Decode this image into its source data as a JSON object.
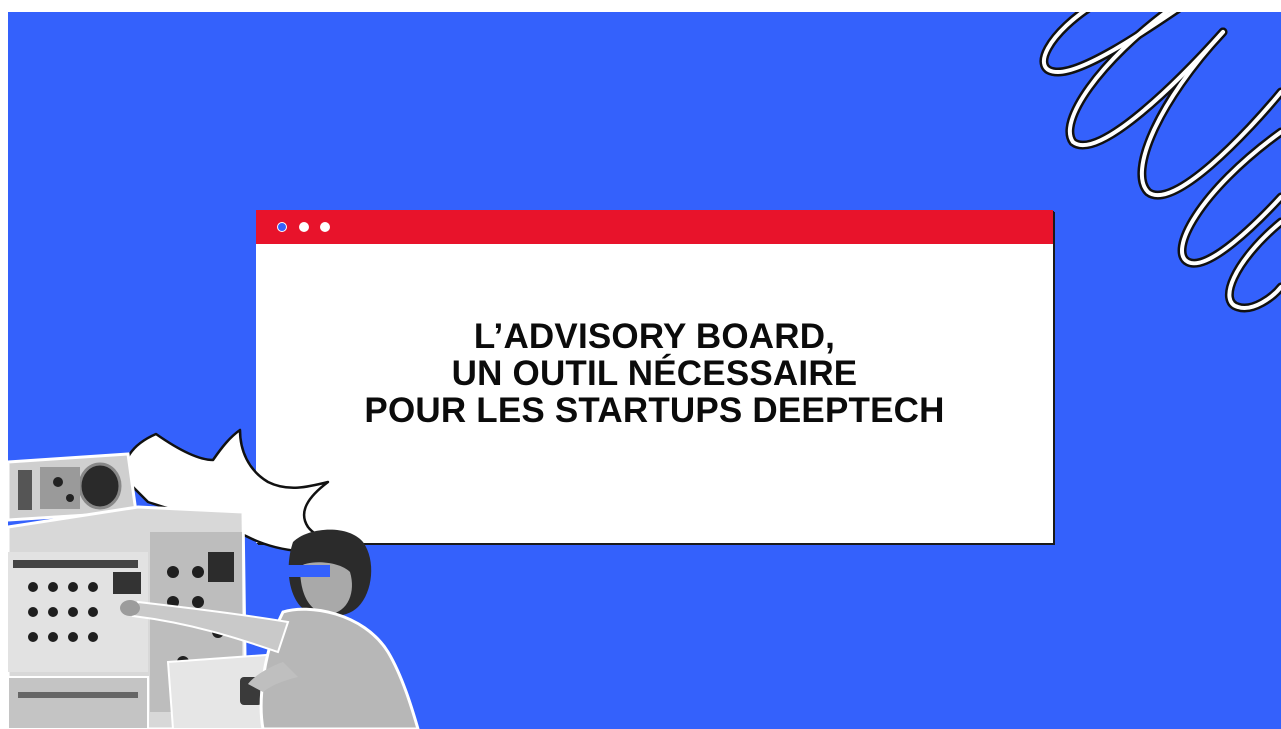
{
  "window": {
    "dot_colors": [
      "#3461fc",
      "#ffffff",
      "#ffffff"
    ],
    "titlebar_color": "#e8132b"
  },
  "headline": {
    "line1": "L’ADVISORY BOARD,",
    "line2": "UN OUTIL NÉCESSAIRE",
    "line3": "POUR LES STARTUPS DEEPTECH"
  },
  "colors": {
    "background": "#3461fc",
    "accent_red": "#e8132b",
    "text": "#0b0b0b"
  },
  "illustration": {
    "subject": "vintage-photo-person-at-electronic-equipment-icon",
    "decoration": "spiral-scribble-icon",
    "callout": "speech-bubble-icon"
  }
}
